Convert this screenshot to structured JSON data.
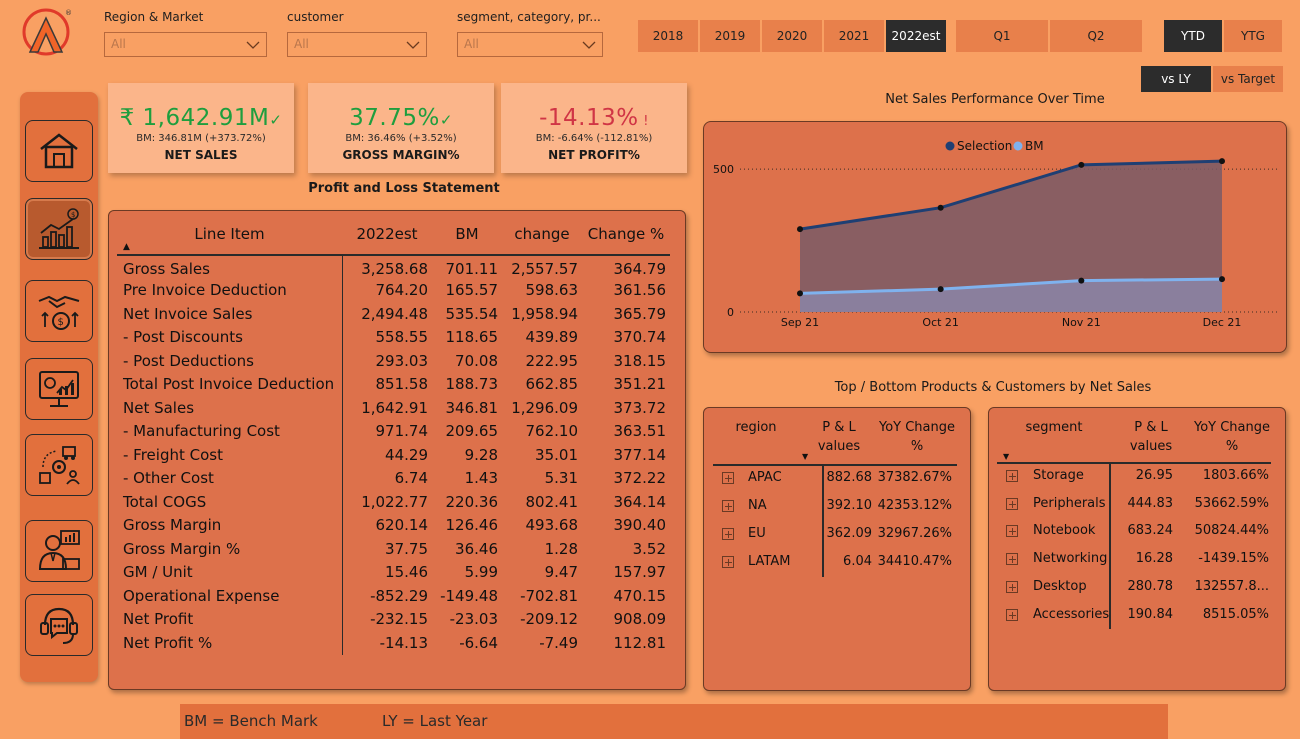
{
  "filters": [
    {
      "label": "Region & Market",
      "value": "All"
    },
    {
      "label": "customer",
      "value": "All"
    },
    {
      "label": "segment, category, pr...",
      "value": "All"
    }
  ],
  "years": [
    "2018",
    "2019",
    "2020",
    "2021",
    "2022est"
  ],
  "active_year": "2022est",
  "quarters": [
    "Q1",
    "Q2"
  ],
  "ytd": [
    "YTD",
    "YTG"
  ],
  "active_ytd": "YTD",
  "compare": [
    "vs LY",
    "vs Target"
  ],
  "active_compare": "vs LY",
  "kpis": {
    "net_sales": {
      "value": "₹ 1,642.91M",
      "sub": "BM: 346.81M (+373.72%)",
      "name": "NET SALES",
      "color": "#1e9e3e"
    },
    "gross_margin": {
      "value": "37.75%",
      "sub": "BM: 36.46% (+3.52%)",
      "name": "GROSS MARGIN%",
      "color": "#1e9e3e"
    },
    "net_profit": {
      "value": "-14.13%",
      "sub": "BM: -6.64% (-112.81%)",
      "name": "NET PROFIT%",
      "color": "#d03545"
    }
  },
  "pl_title": "Profit and Loss Statement",
  "pl_headers": [
    "Line Item",
    "2022est",
    "BM",
    "change",
    "Change %"
  ],
  "pl_rows": [
    [
      "Gross Sales",
      "3,258.68",
      "701.11",
      "2,557.57",
      "364.79"
    ],
    [
      "Pre Invoice Deduction",
      "764.20",
      "165.57",
      "598.63",
      "361.56"
    ],
    [
      "Net Invoice Sales",
      "2,494.48",
      "535.54",
      "1,958.94",
      "365.79"
    ],
    [
      "- Post Discounts",
      "558.55",
      "118.65",
      "439.89",
      "370.74"
    ],
    [
      "- Post Deductions",
      "293.03",
      "70.08",
      "222.95",
      "318.15"
    ],
    [
      "Total Post Invoice Deduction",
      "851.58",
      "188.73",
      "662.85",
      "351.21"
    ],
    [
      "Net Sales",
      "1,642.91",
      "346.81",
      "1,296.09",
      "373.72"
    ],
    [
      "- Manufacturing Cost",
      "971.74",
      "209.65",
      "762.10",
      "363.51"
    ],
    [
      "- Freight Cost",
      "44.29",
      "9.28",
      "35.01",
      "377.14"
    ],
    [
      "- Other Cost",
      "6.74",
      "1.43",
      "5.31",
      "372.22"
    ],
    [
      "Total COGS",
      "1,022.77",
      "220.36",
      "802.41",
      "364.14"
    ],
    [
      "Gross Margin",
      "620.14",
      "126.46",
      "493.68",
      "390.40"
    ],
    [
      "Gross Margin %",
      "37.75",
      "36.46",
      "1.28",
      "3.52"
    ],
    [
      "GM / Unit",
      "15.46",
      "5.99",
      "9.47",
      "157.97"
    ],
    [
      "Operational Expense",
      "-852.29",
      "-149.48",
      "-702.81",
      "470.15"
    ],
    [
      "Net Profit",
      "-232.15",
      "-23.03",
      "-209.12",
      "908.09"
    ],
    [
      "Net Profit %",
      "-14.13",
      "-6.64",
      "-7.49",
      "112.81"
    ]
  ],
  "chart_title": "Net Sales Performance Over Time",
  "chart_data": {
    "type": "area",
    "x": [
      "Sep 21",
      "Oct 21",
      "Nov 21",
      "Dec 21"
    ],
    "series": [
      {
        "name": "Selection",
        "values": [
          290,
          365,
          515,
          528
        ],
        "color": "#1f3f73"
      },
      {
        "name": "BM",
        "values": [
          65,
          80,
          110,
          115
        ],
        "color": "#7fb2ee"
      }
    ],
    "yticks": [
      0,
      500
    ],
    "ylim": [
      0,
      560
    ],
    "legend": "top-center",
    "grid": true
  },
  "tb_title": "Top / Bottom Products & Customers by  Net Sales",
  "region_table": {
    "headers": [
      "region",
      "P & L values",
      "YoY Change %"
    ],
    "rows": [
      [
        "APAC",
        "882.68",
        "37382.67%"
      ],
      [
        "NA",
        "392.10",
        "42353.12%"
      ],
      [
        "EU",
        "362.09",
        "32967.26%"
      ],
      [
        "LATAM",
        "6.04",
        "34410.47%"
      ]
    ]
  },
  "segment_table": {
    "headers": [
      "segment",
      "P & L values",
      "YoY Change %"
    ],
    "rows": [
      [
        "Storage",
        "26.95",
        "1803.66%"
      ],
      [
        "Peripherals",
        "444.83",
        "53662.59%"
      ],
      [
        "Notebook",
        "683.24",
        "50824.44%"
      ],
      [
        "Networking",
        "16.28",
        "-1439.15%"
      ],
      [
        "Desktop",
        "280.78",
        "132557.8..."
      ],
      [
        "Accessories",
        "190.84",
        "8515.05%"
      ]
    ]
  },
  "footer": {
    "bm": "BM = Bench Mark",
    "ly": "LY = Last Year"
  }
}
